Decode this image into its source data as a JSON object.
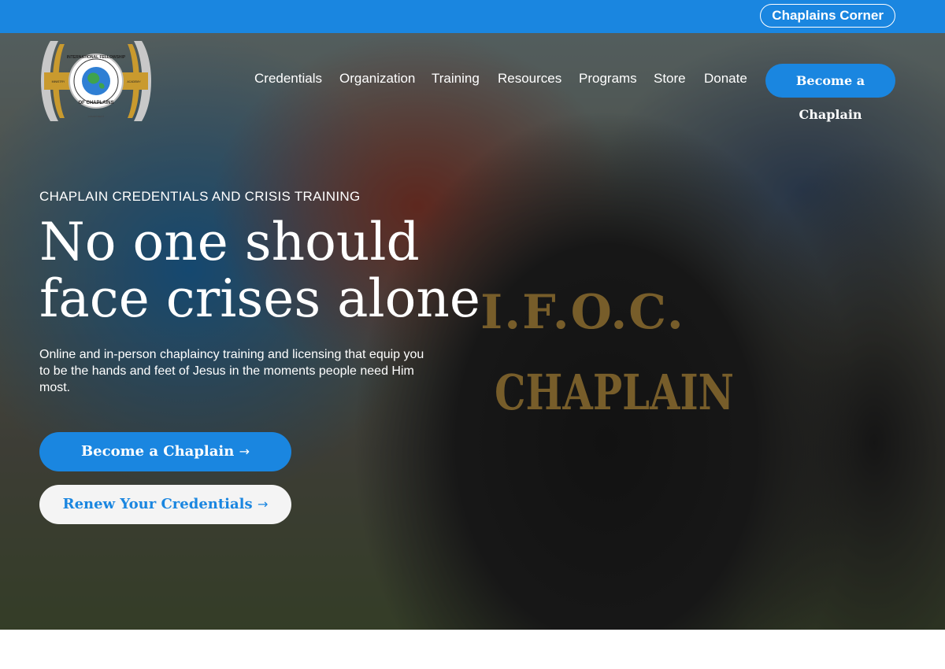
{
  "topbar": {
    "corner_label": "Chaplains Corner"
  },
  "header": {
    "logo_text": {
      "ring": "INTERNATIONAL FELLOWSHIP",
      "bottom": "OF CHAPLAINS",
      "left_wing": "MINISTRY",
      "right_wing": "ACADEMY",
      "base": "COMMITMENT"
    },
    "nav": [
      "Credentials",
      "Organization",
      "Training",
      "Resources",
      "Programs",
      "Store",
      "Donate"
    ],
    "cta_label": "Become a Chaplain"
  },
  "hero": {
    "shirt_line_1": "I.F.O.C.",
    "shirt_line_2": "CHAPLAIN",
    "eyebrow": "CHAPLAIN CREDENTIALS AND CRISIS TRAINING",
    "headline_line_1": "No one should",
    "headline_line_2": "face crises alone",
    "subtext": "Online and in-person chaplaincy training and licensing that equip you to be the hands and feet of Jesus in the moments people need Him most.",
    "primary_button": {
      "label": "Become a Chaplain",
      "arrow": "→"
    },
    "secondary_button": {
      "label": "Renew Your Credentials",
      "arrow": "→"
    }
  },
  "colors": {
    "accent": "#1a86e0",
    "gold": "#c99a2e",
    "white": "#ffffff"
  }
}
